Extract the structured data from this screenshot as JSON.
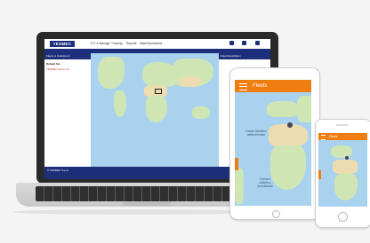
{
  "laptop": {
    "logo_text": "TESMEC",
    "nav_items": [
      "FLT & Manage",
      "Tracking",
      "Reports",
      "Maint/Operations"
    ],
    "left_panel": {
      "header": "Fleets & Customers",
      "line1": "Default Set",
      "line2": "TESMEC Demo (1)"
    },
    "right_panel": {
      "header": "Fleet Description"
    },
    "footer_text": "© TESMEC S.p.A."
  },
  "tablet": {
    "title": "Fleets",
    "ocean_label_1": "Ocean Atlantico\nsettentrionale",
    "ocean_label_2": "Oceano\nAtlantico\nmeridionale"
  },
  "phone": {
    "title": "Fleets"
  },
  "colors": {
    "brand_navy": "#1d2f7a",
    "app_orange": "#f07d10",
    "ocean": "#a8d2ee",
    "land": "#cfe6b4"
  }
}
